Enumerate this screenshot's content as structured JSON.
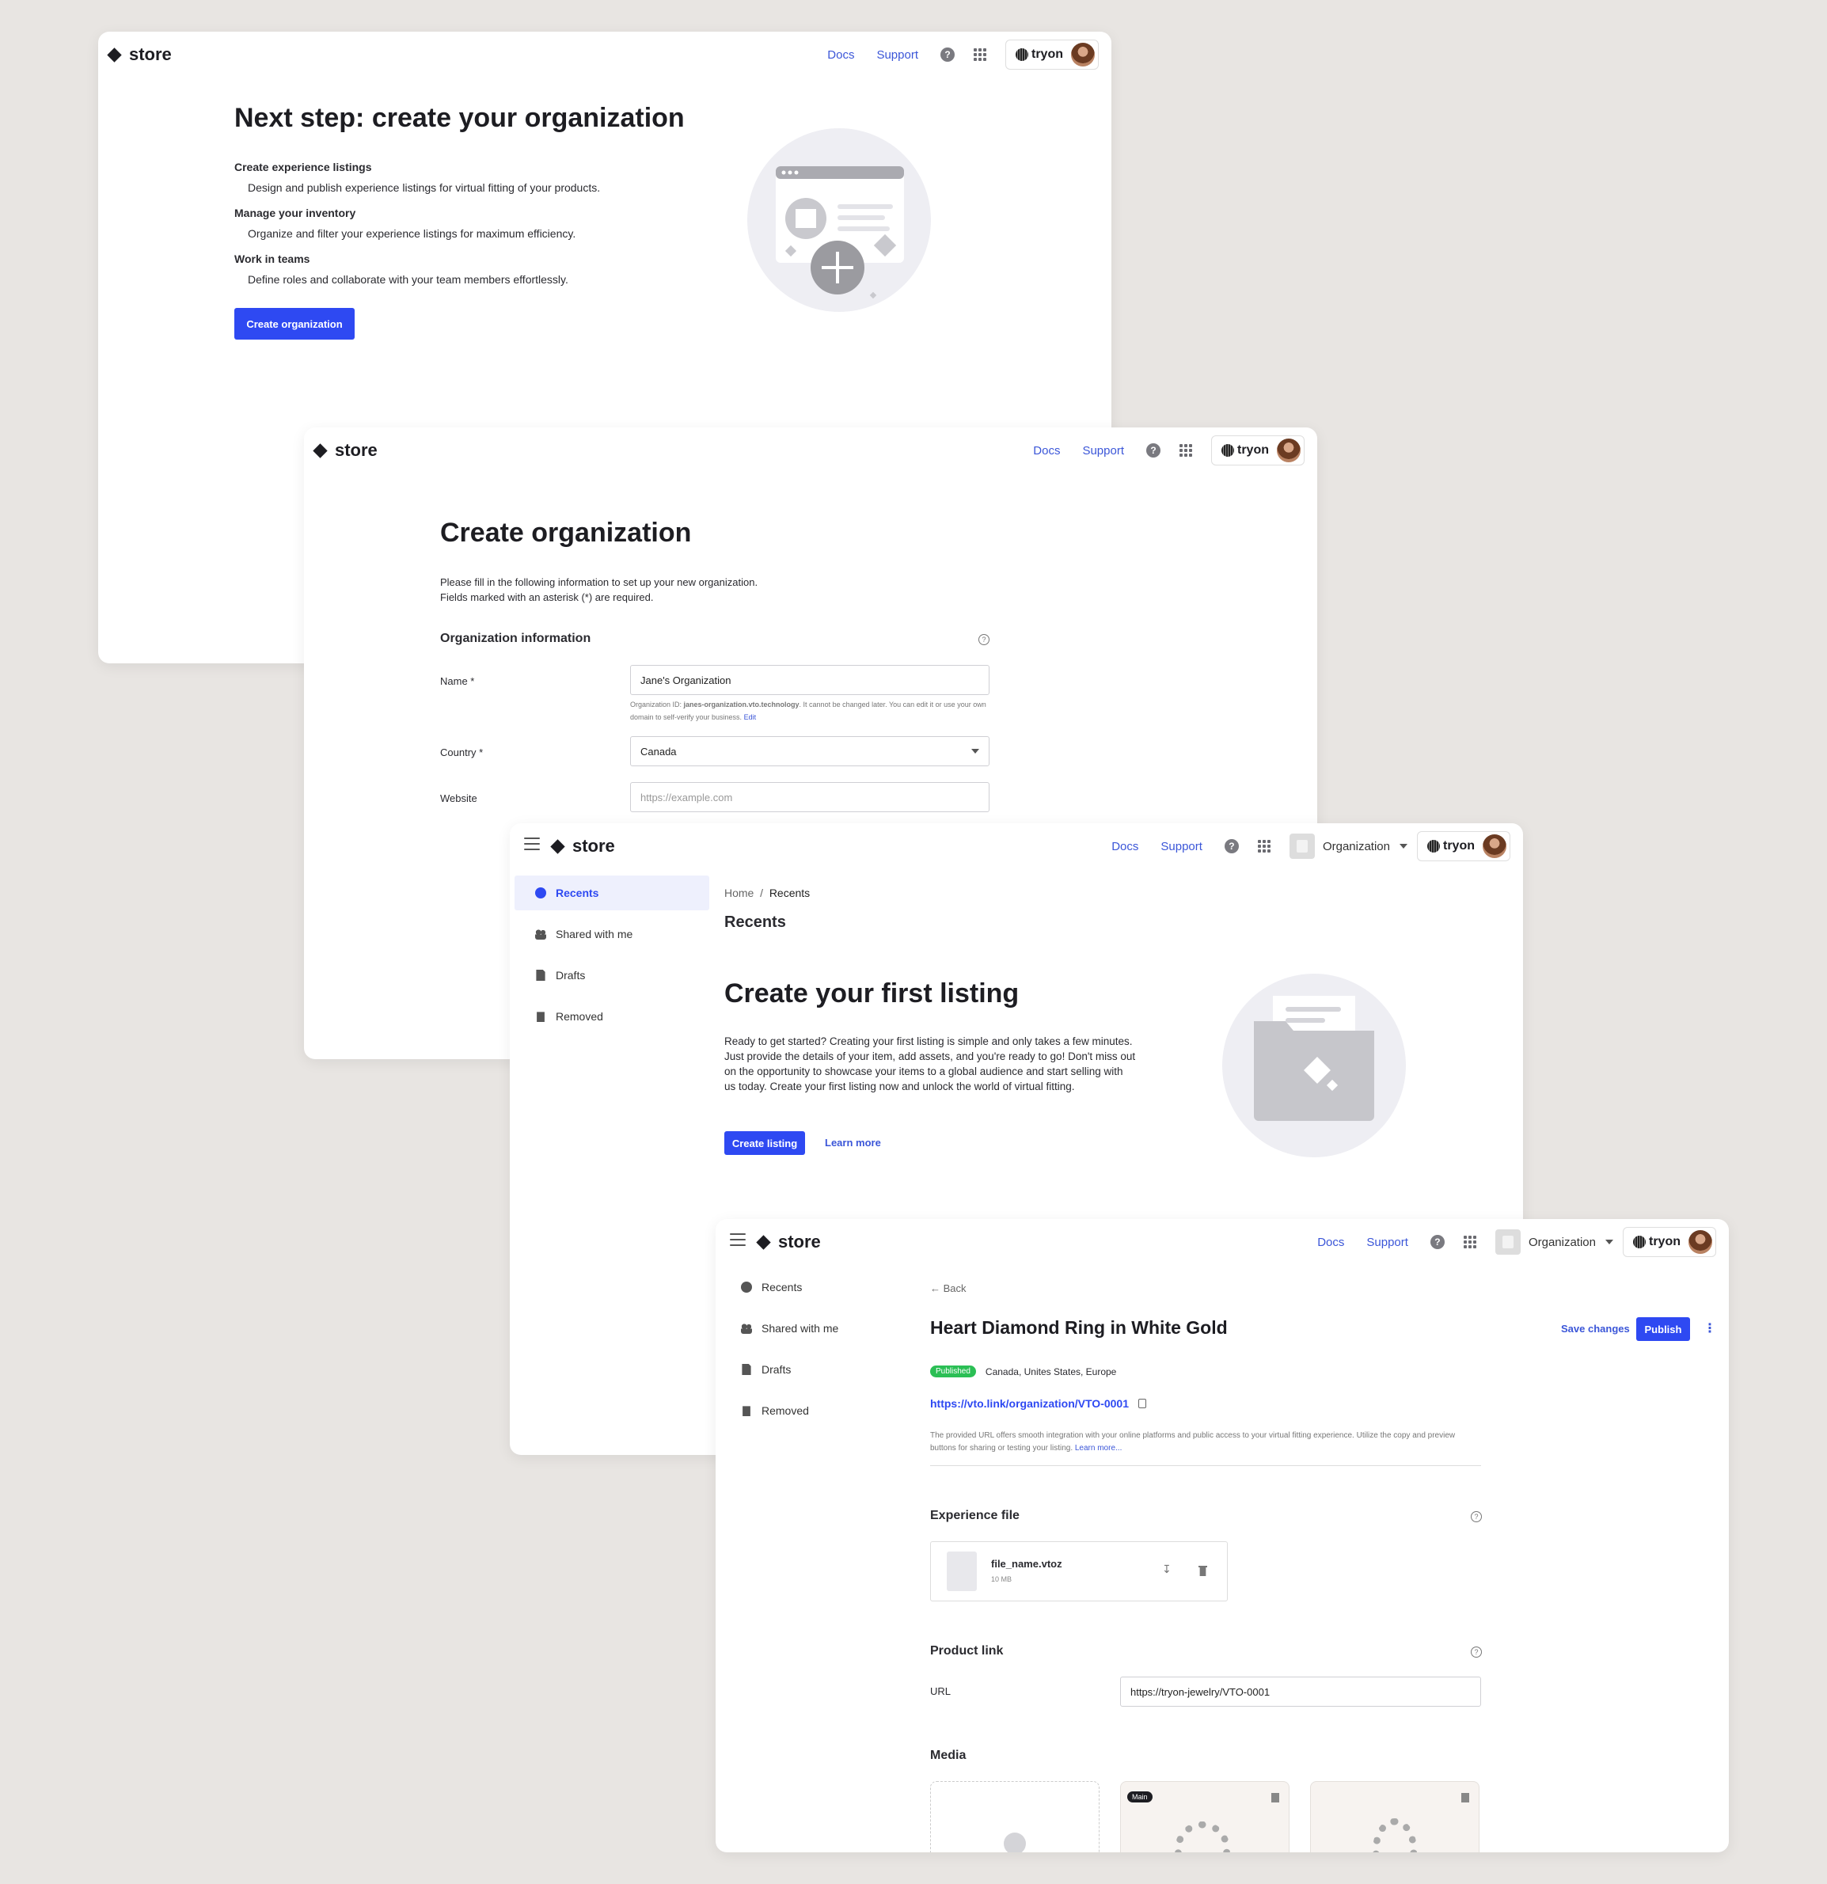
{
  "common": {
    "logo": "store",
    "docs": "Docs",
    "support": "Support",
    "help": "?",
    "brand": "tryon",
    "organization": "Organization"
  },
  "screen1": {
    "title": "Next step: create your organization",
    "features": [
      {
        "heading": "Create experience listings",
        "desc": "Design and publish experience listings for virtual fitting of your products."
      },
      {
        "heading": "Manage your inventory",
        "desc": "Organize and filter your experience listings for maximum efficiency."
      },
      {
        "heading": "Work in teams",
        "desc": "Define roles and collaborate with your team members effortlessly."
      }
    ],
    "cta": "Create organization"
  },
  "screen2": {
    "title": "Create organization",
    "intro1": "Please fill in the following information to set up your new organization.",
    "intro2": "Fields marked with an asterisk (*) are required.",
    "section": "Organization information",
    "name_label": "Name *",
    "name_value": "Jane's Organization",
    "hint_prefix": "Organization ID: ",
    "hint_id": "janes-organization.vto.technology",
    "hint_rest": ". It cannot be changed later. You can edit it or use your own domain to self-verify your business. ",
    "hint_edit": "Edit",
    "country_label": "Country *",
    "country_value": "Canada",
    "website_label": "Website",
    "website_placeholder": "https://example.com"
  },
  "sidebar": {
    "items": [
      "Recents",
      "Shared with me",
      "Drafts",
      "Removed"
    ]
  },
  "screen3": {
    "breadcrumb_home": "Home",
    "breadcrumb_sep": "/",
    "breadcrumb_current": "Recents",
    "page_title": "Recents",
    "heading": "Create your first listing",
    "body": "Ready to get started? Creating your first listing is simple and only takes a few minutes. Just provide the details of your item, add assets, and you're ready to go! Don't miss out on the opportunity to showcase your items to a global audience and start selling with us today. Create your first listing now and unlock the world of virtual fitting.",
    "create": "Create listing",
    "learn": "Learn more"
  },
  "screen4": {
    "back": "Back",
    "title": "Heart Diamond Ring in White Gold",
    "save": "Save changes",
    "publish": "Publish",
    "status": "Published",
    "regions": "Canada, Unites States, Europe",
    "url": "https://vto.link/organization/VTO-0001",
    "desc": "The provided URL offers smooth integration with your online platforms and public access to your virtual fitting experience. Utilize the copy and preview buttons for sharing or testing your listing. ",
    "desc_link": "Learn more...",
    "exp_title": "Experience file",
    "file_name": "file_name.vtoz",
    "file_size": "10 MB",
    "product_title": "Product link",
    "url_label": "URL",
    "url_value": "https://tryon-jewelry/VTO-0001",
    "media_title": "Media",
    "main_badge": "Main"
  }
}
